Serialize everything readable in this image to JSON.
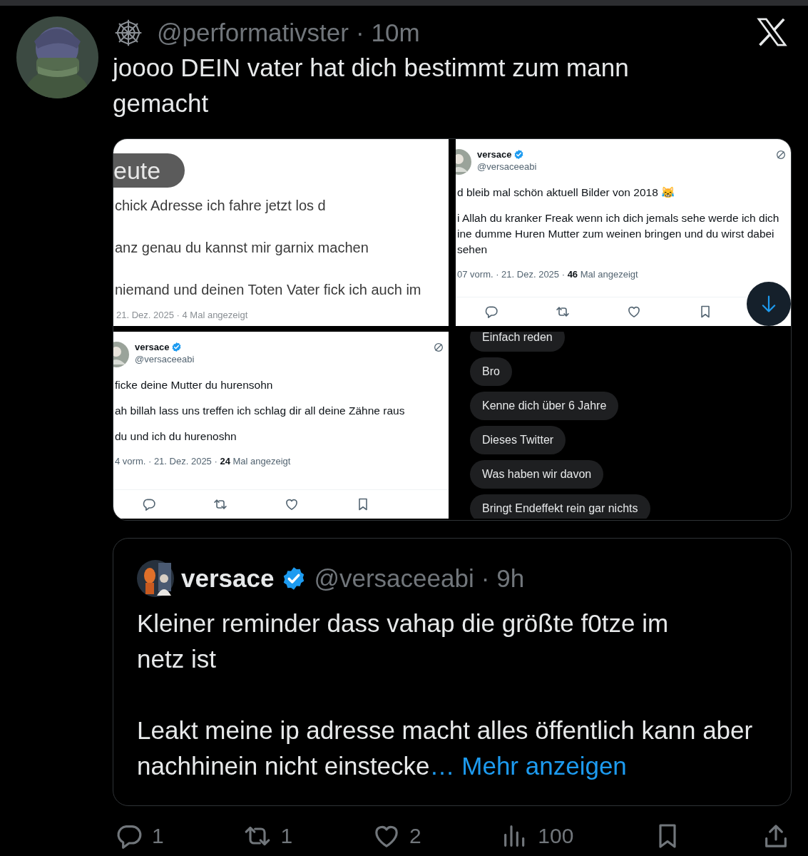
{
  "post": {
    "handle": "@performativster",
    "separator": "·",
    "time": "10m",
    "text": "joooo DEIN vater hat dich bestimmt zum mann gemacht"
  },
  "media": [
    {
      "kind": "text_messages",
      "pill": "eute",
      "lines": [
        "chick Adresse ich fahre jetzt los d",
        "anz genau du kannst mir garnix machen",
        "niemand und deinen Toten Vater fick ich auch im"
      ],
      "footer": "21. Dez. 2025 · 4 Mal angezeigt"
    },
    {
      "kind": "tweet",
      "name": "versace",
      "verified": true,
      "handle": "@versaceeabi",
      "paragraphs": [
        [
          "d bleib mal schön aktuell Bilder von 2018 😹"
        ],
        [
          "i Allah du kranker Freak wenn ich dich jemals sehe werde ich dich",
          "ine dumme Huren Mutter zum weinen bringen und du wirst dabei",
          "sehen"
        ]
      ],
      "meta": "07 vorm. · 21. Dez. 2025 · **46** Mal angezeigt",
      "scroll_button": true
    },
    {
      "kind": "tweet",
      "name": "versace",
      "verified": true,
      "handle": "@versaceeabi",
      "paragraphs": [
        [
          "ficke deine Mutter du hurensohn"
        ],
        [
          "ah billah lass uns treffen ich schlag dir all deine Zähne raus"
        ],
        [
          "du und ich du hurenoshn"
        ]
      ],
      "meta": "4 vorm. · 21. Dez. 2025 · **24** Mal angezeigt",
      "scroll_button": false
    },
    {
      "kind": "chat",
      "bubbles": [
        "Einfach reden",
        "Bro",
        "Kenne dich über 6 Jahre",
        "Dieses Twitter",
        "Was haben wir davon",
        "Bringt Endeffekt rein gar nichts"
      ]
    }
  ],
  "quote": {
    "name": "versace",
    "verified": true,
    "handle": "@versaceeabi",
    "separator": "·",
    "time": "9h",
    "paragraphs": [
      "Kleiner reminder dass vahap die größte f0tze im netz ist",
      "Leakt meine ip adresse macht alles öffentlich kann aber nachhinein nicht einstecke"
    ],
    "more": "… Mehr anzeigen"
  },
  "actions": [
    {
      "kind": "reply",
      "count": "1"
    },
    {
      "kind": "repost",
      "count": "1"
    },
    {
      "kind": "like",
      "count": "2"
    },
    {
      "kind": "views",
      "count": "100"
    },
    {
      "kind": "bookmark"
    },
    {
      "kind": "share"
    }
  ]
}
